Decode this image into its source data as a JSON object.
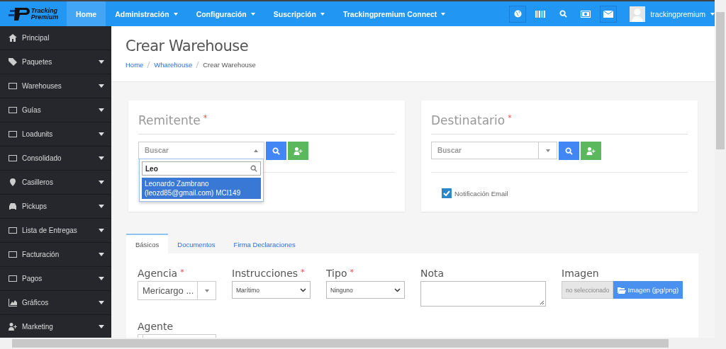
{
  "logo": {
    "line_1": "Tracking",
    "line_2": "Premium"
  },
  "nav": [
    {
      "label": "Home",
      "selected": true,
      "dropdown": false
    },
    {
      "label": "Administración",
      "selected": false,
      "dropdown": true
    },
    {
      "label": "Configuración",
      "selected": false,
      "dropdown": true
    },
    {
      "label": "Suscripción",
      "selected": false,
      "dropdown": true
    },
    {
      "label": "Trackingpremium Connect",
      "selected": false,
      "dropdown": true
    }
  ],
  "user": {
    "name": "trackingpremium"
  },
  "sidebar": {
    "items": [
      {
        "label": "Principal",
        "expandable": false
      },
      {
        "label": "Paquetes",
        "expandable": true
      },
      {
        "label": "Warehouses",
        "expandable": true
      },
      {
        "label": "Guías",
        "expandable": true
      },
      {
        "label": "Loadunits",
        "expandable": true
      },
      {
        "label": "Consolidado",
        "expandable": true
      },
      {
        "label": "Casilleros",
        "expandable": true
      },
      {
        "label": "Pickups",
        "expandable": true
      },
      {
        "label": "Lista de Entregas",
        "expandable": true
      },
      {
        "label": "Facturación",
        "expandable": true
      },
      {
        "label": "Pagos",
        "expandable": true
      },
      {
        "label": "Gráficos",
        "expandable": true
      },
      {
        "label": "Marketing",
        "expandable": true
      }
    ]
  },
  "page": {
    "title": "Crear Warehouse",
    "breadcrumb": [
      {
        "label": "Home",
        "link": true
      },
      {
        "label": "Wharehouse",
        "link": true
      },
      {
        "label": "Crear Warehouse",
        "link": false
      }
    ]
  },
  "remitente": {
    "title": "Remitente",
    "required_mark": "*",
    "select": {
      "placeholder": "Buscar",
      "open": true
    },
    "dropdown": {
      "search_value": "Leo",
      "options": [
        {
          "label": "Leonardo Zambrano (leozd85@gmail.com) MCI149",
          "selected": true
        }
      ]
    }
  },
  "destinatario": {
    "title": "Destinatario",
    "required_mark": "*",
    "select": {
      "placeholder": "Buscar",
      "open": false
    },
    "notification": {
      "label": "Notificación Email",
      "checked": true
    }
  },
  "tabs": [
    {
      "label": "Básicos",
      "selected": true
    },
    {
      "label": "Documentos",
      "selected": false
    },
    {
      "label": "Firma Declaraciones",
      "selected": false
    }
  ],
  "form": {
    "fields": [
      {
        "kind": "select2",
        "label": "Agencia",
        "required_mark": "*",
        "value": "Mericargo ..."
      },
      {
        "kind": "select",
        "label": "Instrucciones",
        "required_mark": "*",
        "value": "Marítimo"
      },
      {
        "kind": "select",
        "label": "Tipo",
        "required_mark": "*",
        "value": "Ninguno"
      },
      {
        "kind": "textarea",
        "label": "Nota"
      },
      {
        "kind": "file",
        "label": "Imagen",
        "placeholder": "no seleccionado",
        "button": "Imagen (jpg/png)"
      }
    ],
    "second_row": [
      {
        "kind": "select2",
        "label": "Agente"
      }
    ]
  }
}
